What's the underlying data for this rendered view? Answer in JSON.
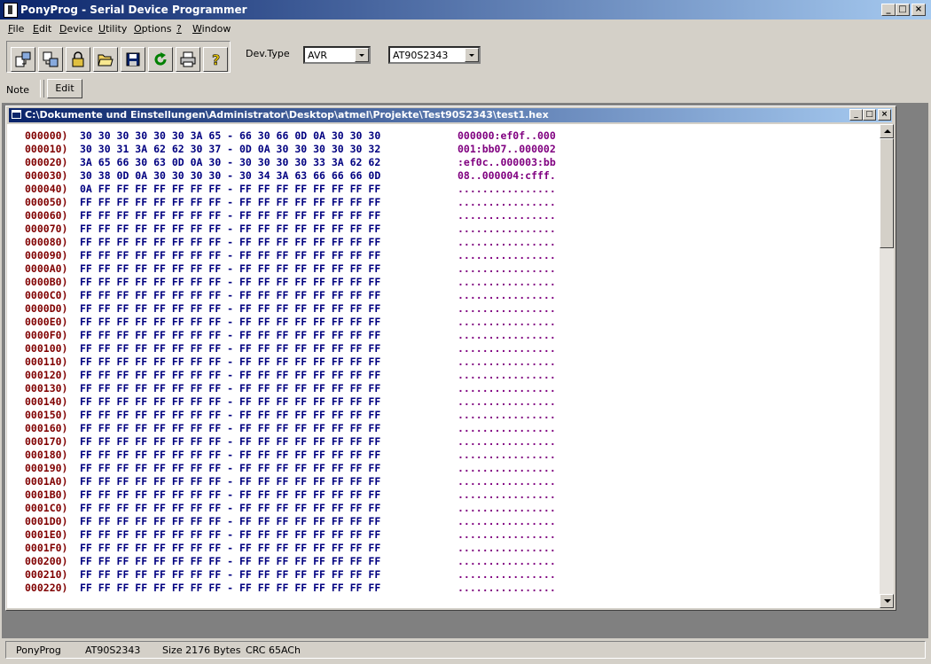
{
  "window": {
    "title": "PonyProg - Serial Device Programmer"
  },
  "menu": [
    "File",
    "Edit",
    "Device",
    "Utility",
    "Options",
    "?",
    "Window"
  ],
  "menu_accel": [
    "F",
    "E",
    "D",
    "U",
    "O",
    "?",
    "W"
  ],
  "toolbar": {
    "buttons": [
      "read-device-icon",
      "write-device-icon",
      "lock-icon",
      "open-folder-icon",
      "save-icon",
      "reload-icon",
      "print-icon",
      "help-icon"
    ],
    "devtype_label": "Dev.Type",
    "family": "AVR",
    "device": "AT90S2343"
  },
  "notebar": {
    "label": "Note",
    "edit_button": "Edit"
  },
  "child_window": {
    "title": "C:\\Dokumente und Einstellungen\\Administrator\\Desktop\\atmel\\Projekte\\Test90S2343\\test1.hex"
  },
  "hex_rows": [
    {
      "addr": "000000)",
      "bytes": "30 30 30 30 30 30 3A 65 - 66 30 66 0D 0A 30 30 30",
      "ascii": "000000:ef0f..000"
    },
    {
      "addr": "000010)",
      "bytes": "30 30 31 3A 62 62 30 37 - 0D 0A 30 30 30 30 30 32",
      "ascii": "001:bb07..000002"
    },
    {
      "addr": "000020)",
      "bytes": "3A 65 66 30 63 0D 0A 30 - 30 30 30 30 33 3A 62 62",
      "ascii": ":ef0c..000003:bb"
    },
    {
      "addr": "000030)",
      "bytes": "30 38 0D 0A 30 30 30 30 - 30 34 3A 63 66 66 66 0D",
      "ascii": "08..000004:cfff."
    },
    {
      "addr": "000040)",
      "bytes": "0A FF FF FF FF FF FF FF - FF FF FF FF FF FF FF FF",
      "ascii": "................"
    },
    {
      "addr": "000050)",
      "bytes": "FF FF FF FF FF FF FF FF - FF FF FF FF FF FF FF FF",
      "ascii": "................"
    },
    {
      "addr": "000060)",
      "bytes": "FF FF FF FF FF FF FF FF - FF FF FF FF FF FF FF FF",
      "ascii": "................"
    },
    {
      "addr": "000070)",
      "bytes": "FF FF FF FF FF FF FF FF - FF FF FF FF FF FF FF FF",
      "ascii": "................"
    },
    {
      "addr": "000080)",
      "bytes": "FF FF FF FF FF FF FF FF - FF FF FF FF FF FF FF FF",
      "ascii": "................"
    },
    {
      "addr": "000090)",
      "bytes": "FF FF FF FF FF FF FF FF - FF FF FF FF FF FF FF FF",
      "ascii": "................"
    },
    {
      "addr": "0000A0)",
      "bytes": "FF FF FF FF FF FF FF FF - FF FF FF FF FF FF FF FF",
      "ascii": "................"
    },
    {
      "addr": "0000B0)",
      "bytes": "FF FF FF FF FF FF FF FF - FF FF FF FF FF FF FF FF",
      "ascii": "................"
    },
    {
      "addr": "0000C0)",
      "bytes": "FF FF FF FF FF FF FF FF - FF FF FF FF FF FF FF FF",
      "ascii": "................"
    },
    {
      "addr": "0000D0)",
      "bytes": "FF FF FF FF FF FF FF FF - FF FF FF FF FF FF FF FF",
      "ascii": "................"
    },
    {
      "addr": "0000E0)",
      "bytes": "FF FF FF FF FF FF FF FF - FF FF FF FF FF FF FF FF",
      "ascii": "................"
    },
    {
      "addr": "0000F0)",
      "bytes": "FF FF FF FF FF FF FF FF - FF FF FF FF FF FF FF FF",
      "ascii": "................"
    },
    {
      "addr": "000100)",
      "bytes": "FF FF FF FF FF FF FF FF - FF FF FF FF FF FF FF FF",
      "ascii": "................"
    },
    {
      "addr": "000110)",
      "bytes": "FF FF FF FF FF FF FF FF - FF FF FF FF FF FF FF FF",
      "ascii": "................"
    },
    {
      "addr": "000120)",
      "bytes": "FF FF FF FF FF FF FF FF - FF FF FF FF FF FF FF FF",
      "ascii": "................"
    },
    {
      "addr": "000130)",
      "bytes": "FF FF FF FF FF FF FF FF - FF FF FF FF FF FF FF FF",
      "ascii": "................"
    },
    {
      "addr": "000140)",
      "bytes": "FF FF FF FF FF FF FF FF - FF FF FF FF FF FF FF FF",
      "ascii": "................"
    },
    {
      "addr": "000150)",
      "bytes": "FF FF FF FF FF FF FF FF - FF FF FF FF FF FF FF FF",
      "ascii": "................"
    },
    {
      "addr": "000160)",
      "bytes": "FF FF FF FF FF FF FF FF - FF FF FF FF FF FF FF FF",
      "ascii": "................"
    },
    {
      "addr": "000170)",
      "bytes": "FF FF FF FF FF FF FF FF - FF FF FF FF FF FF FF FF",
      "ascii": "................"
    },
    {
      "addr": "000180)",
      "bytes": "FF FF FF FF FF FF FF FF - FF FF FF FF FF FF FF FF",
      "ascii": "................"
    },
    {
      "addr": "000190)",
      "bytes": "FF FF FF FF FF FF FF FF - FF FF FF FF FF FF FF FF",
      "ascii": "................"
    },
    {
      "addr": "0001A0)",
      "bytes": "FF FF FF FF FF FF FF FF - FF FF FF FF FF FF FF FF",
      "ascii": "................"
    },
    {
      "addr": "0001B0)",
      "bytes": "FF FF FF FF FF FF FF FF - FF FF FF FF FF FF FF FF",
      "ascii": "................"
    },
    {
      "addr": "0001C0)",
      "bytes": "FF FF FF FF FF FF FF FF - FF FF FF FF FF FF FF FF",
      "ascii": "................"
    },
    {
      "addr": "0001D0)",
      "bytes": "FF FF FF FF FF FF FF FF - FF FF FF FF FF FF FF FF",
      "ascii": "................"
    },
    {
      "addr": "0001E0)",
      "bytes": "FF FF FF FF FF FF FF FF - FF FF FF FF FF FF FF FF",
      "ascii": "................"
    },
    {
      "addr": "0001F0)",
      "bytes": "FF FF FF FF FF FF FF FF - FF FF FF FF FF FF FF FF",
      "ascii": "................"
    },
    {
      "addr": "000200)",
      "bytes": "FF FF FF FF FF FF FF FF - FF FF FF FF FF FF FF FF",
      "ascii": "................"
    },
    {
      "addr": "000210)",
      "bytes": "FF FF FF FF FF FF FF FF - FF FF FF FF FF FF FF FF",
      "ascii": "................"
    },
    {
      "addr": "000220)",
      "bytes": "FF FF FF FF FF FF FF FF - FF FF FF FF FF FF FF FF",
      "ascii": "................"
    }
  ],
  "status": {
    "app": "PonyProg",
    "device": "AT90S2343",
    "size": "Size  2176 Bytes",
    "crc": "CRC  65ACh"
  },
  "colors": {
    "title_active": "#0a246a",
    "address": "#800000",
    "bytes": "#000080",
    "ascii": "#800080"
  }
}
